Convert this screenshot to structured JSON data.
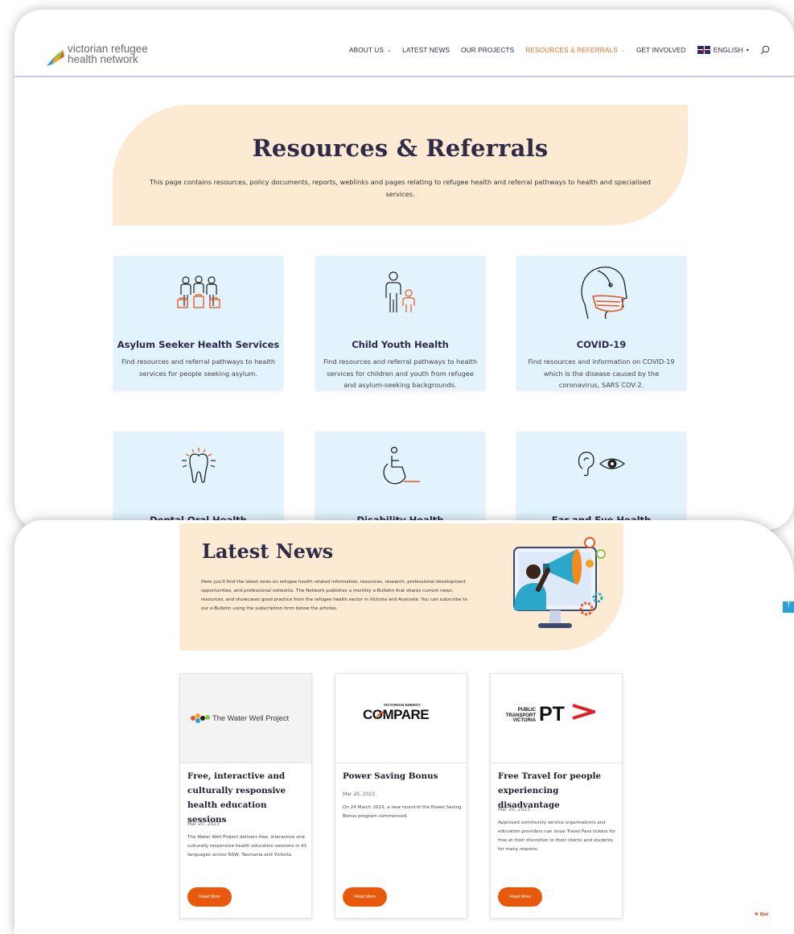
{
  "header": {
    "logo_line1": "victorian refugee",
    "logo_line2": "health network",
    "nav": [
      {
        "label": "ABOUT US",
        "dropdown": true,
        "active": false
      },
      {
        "label": "LATEST NEWS",
        "dropdown": false,
        "active": false
      },
      {
        "label": "OUR PROJECTS",
        "dropdown": false,
        "active": false
      },
      {
        "label": "RESOURCES & REFERRALS",
        "dropdown": true,
        "active": true
      },
      {
        "label": "GET INVOLVED",
        "dropdown": false,
        "active": false
      }
    ],
    "language": "ENGLISH",
    "accent_color": "#e8731e"
  },
  "hero": {
    "title": "Resources & Referrals",
    "description": "This page contains resources, policy documents, reports, weblinks and pages relating to refugee health and referral pathways to health and specialised services."
  },
  "cards": [
    {
      "title": "Asylum Seeker Health Services",
      "description": "Find resources and referral pathways to health services for people seeking asylum.",
      "icon": "people-luggage-icon"
    },
    {
      "title": "Child Youth Health",
      "description": "Find resources and referral pathways to health services for children and youth from refugee and asylum-seeking backgrounds.",
      "icon": "adult-child-icon"
    },
    {
      "title": "COVID-19",
      "description": "Find resources and information on COVID-19 which is the disease caused by the coronavirus, SARS COV-2.",
      "icon": "face-mask-icon"
    },
    {
      "title": "Dental Oral Health",
      "description": "",
      "icon": "tooth-icon"
    },
    {
      "title": "Disability Health",
      "description": "",
      "icon": "wheelchair-icon"
    },
    {
      "title": "Ear and Eye Health",
      "description": "",
      "icon": "ear-eye-icon"
    }
  ],
  "latest_news": {
    "title": "Latest News",
    "description": "Here you'll find the latest news on refugee health related information, resources, research, professional development opportunities, and professional networks. The Network publishes a monthly e-Bulletin that shares current news, resources, and showcases good practice from the refugee health sector in Victoria and Australia. You can subscribe to our e-Bulletin using the subscription form below the articles.",
    "articles": [
      {
        "logo_text": "The Water Well Project",
        "title": "Free, interactive and culturally responsive health education sessions",
        "date": "Mar 20, 2023",
        "excerpt": "The Water Well Project delivers free, interactive and culturally responsive health education sessions in 41 languages across NSW, Tasmania and Victoria.",
        "button": "Read More"
      },
      {
        "logo_top": "VICTORIAN ENERGY",
        "logo_main": "COMPARE",
        "title": "Power Saving Bonus",
        "date": "Mar 20, 2023",
        "excerpt": "On 24 March 2023, a new round of the Power Saving Bonus program commenced.",
        "button": "Read More"
      },
      {
        "logo_lines": [
          "PUBLIC",
          "TRANSPORT",
          "VICTORIA"
        ],
        "logo_main": "PT",
        "title": "Free Travel for people experiencing disadvantage",
        "date": "Mar 20, 2023",
        "excerpt": "Approved community service organisations and education providers can issue Travel Pass tickets for free at their discretion to their clients and students for many reasons.",
        "button": "Read More"
      }
    ]
  },
  "quiz_close": "✖ Qui"
}
